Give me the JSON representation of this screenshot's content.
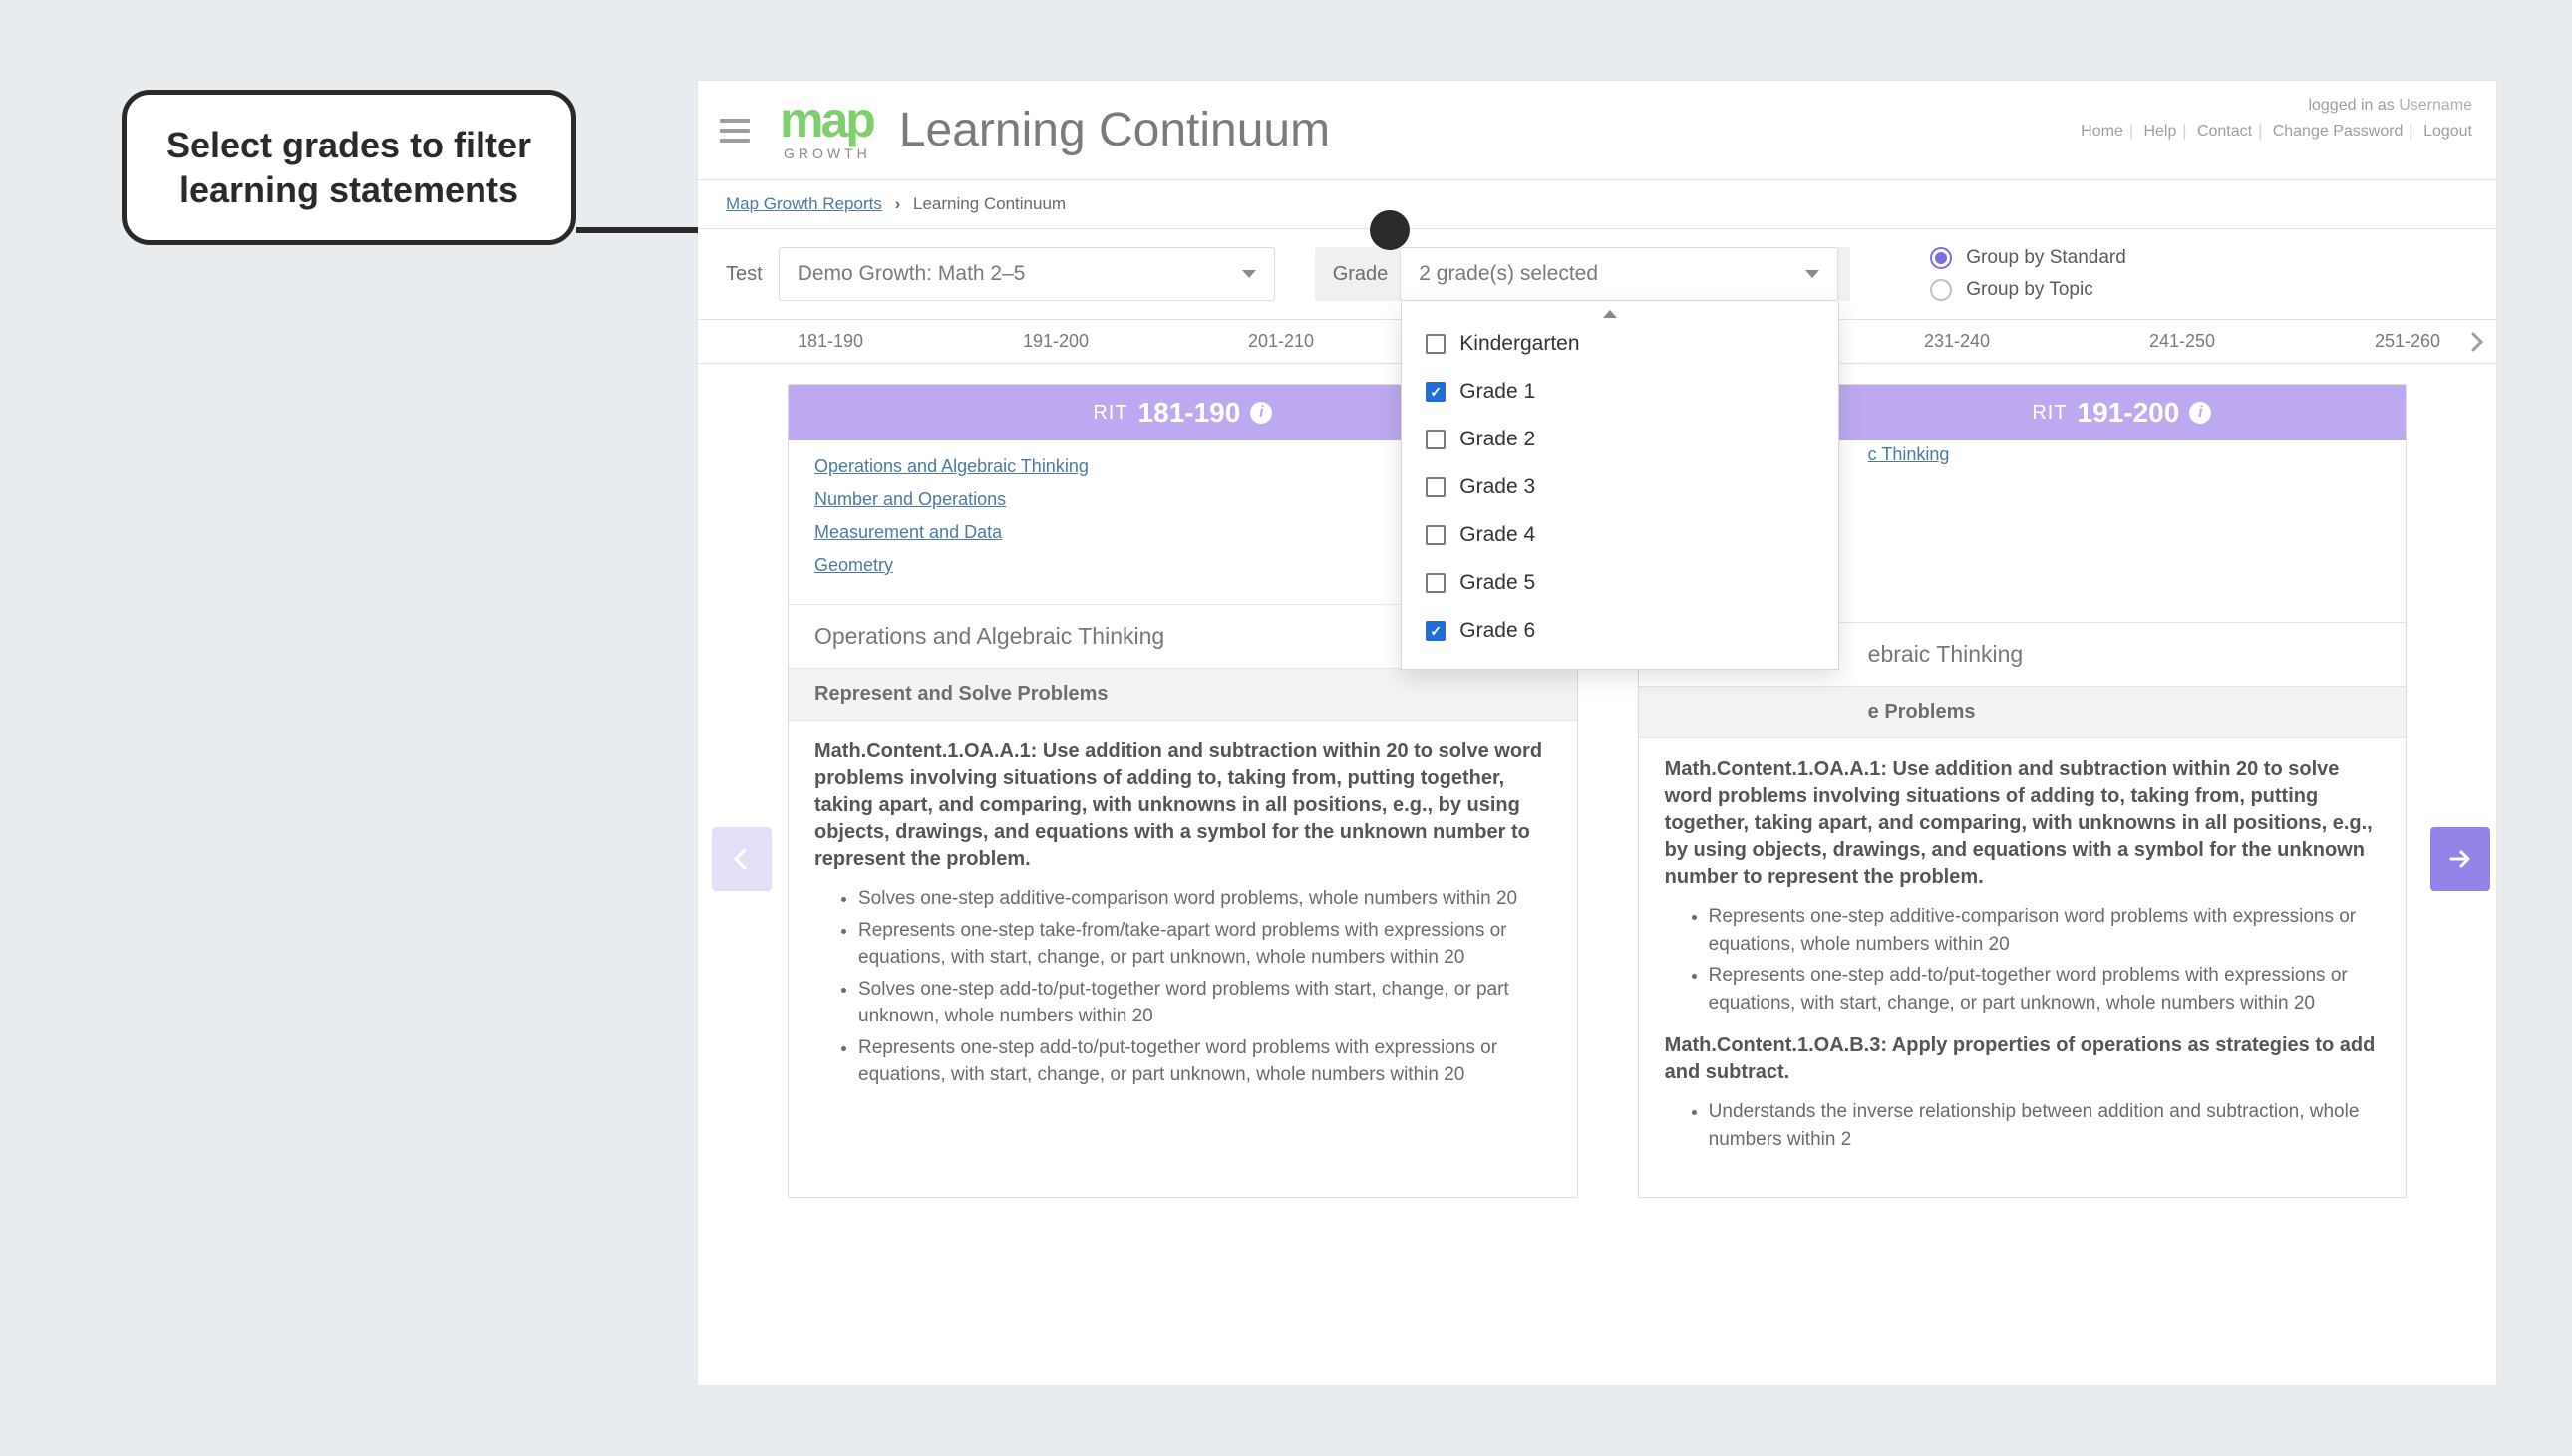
{
  "callout": "Select grades to filter learning statements",
  "header": {
    "logo_main": "map",
    "logo_sub": "GROWTH",
    "page_title": "Learning Continuum",
    "logged_in_prefix": "logged in as ",
    "username": "Username",
    "nav": [
      "Home",
      "Help",
      "Contact",
      "Change Password",
      "Logout"
    ]
  },
  "breadcrumb": {
    "root": "Map Growth Reports",
    "current": "Learning Continuum"
  },
  "filters": {
    "test_label": "Test",
    "test_value": "Demo Growth:  Math 2–5",
    "grade_label": "Grade",
    "grade_value": "2 grade(s) selected",
    "grade_options": [
      {
        "label": "Kindergarten",
        "checked": false
      },
      {
        "label": "Grade 1",
        "checked": true
      },
      {
        "label": "Grade 2",
        "checked": false
      },
      {
        "label": "Grade 3",
        "checked": false
      },
      {
        "label": "Grade 4",
        "checked": false
      },
      {
        "label": "Grade 5",
        "checked": false
      },
      {
        "label": "Grade 6",
        "checked": true
      }
    ],
    "group_standard": "Group by Standard",
    "group_topic": "Group by Topic"
  },
  "bands": [
    "181-190",
    "191-200",
    "201-210",
    "",
    "",
    "231-240",
    "241-250",
    "251-260"
  ],
  "cards": [
    {
      "rit_label": "RIT",
      "rit_value": "181-190",
      "links": [
        "Operations and Algebraic Thinking",
        "Number and Operations",
        "Measurement and Data",
        "Geometry"
      ],
      "section": "Operations and Algebraic Thinking",
      "sub": "Represent and Solve Problems",
      "standards": [
        {
          "title": "Math.Content.1.OA.A.1: Use addition and subtraction within 20 to solve word problems involving situations of adding to, taking from, putting together, taking apart, and comparing, with unknowns in all positions, e.g., by using objects, drawings, and equations with a symbol for the unknown number to represent the problem.",
          "bullets": [
            "Solves one-step additive-comparison word problems, whole numbers within 20",
            "Represents one-step take-from/take-apart word problems with expressions or equations, with start, change, or part unknown, whole numbers within 20",
            "Solves one-step add-to/put-together word problems with start, change, or part unknown, whole numbers within 20",
            "Represents one-step add-to/put-together word problems with expressions or equations, with start, change, or part unknown, whole numbers within 20"
          ]
        }
      ]
    },
    {
      "rit_label": "RIT",
      "rit_value": "191-200",
      "peek_link": "c Thinking",
      "section": "ebraic Thinking",
      "sub": "e Problems",
      "standards": [
        {
          "title": "Math.Content.1.OA.A.1: Use addition and subtraction within 20 to solve word problems involving situations of adding to, taking from, putting together, taking apart, and comparing, with unknowns in all positions, e.g., by using objects, drawings, and equations with a symbol for the unknown number to represent the problem.",
          "bullets": [
            "Represents one-step additive-comparison word problems with expressions or equations, whole numbers within 20",
            "Represents one-step add-to/put-together word problems with expressions or equations, with start, change, or part unknown, whole numbers within 20"
          ]
        },
        {
          "title": "Math.Content.1.OA.B.3: Apply properties of operations as strategies to add and subtract.",
          "bullets": [
            "Understands the inverse relationship between addition and subtraction, whole numbers within 2"
          ]
        }
      ]
    }
  ]
}
